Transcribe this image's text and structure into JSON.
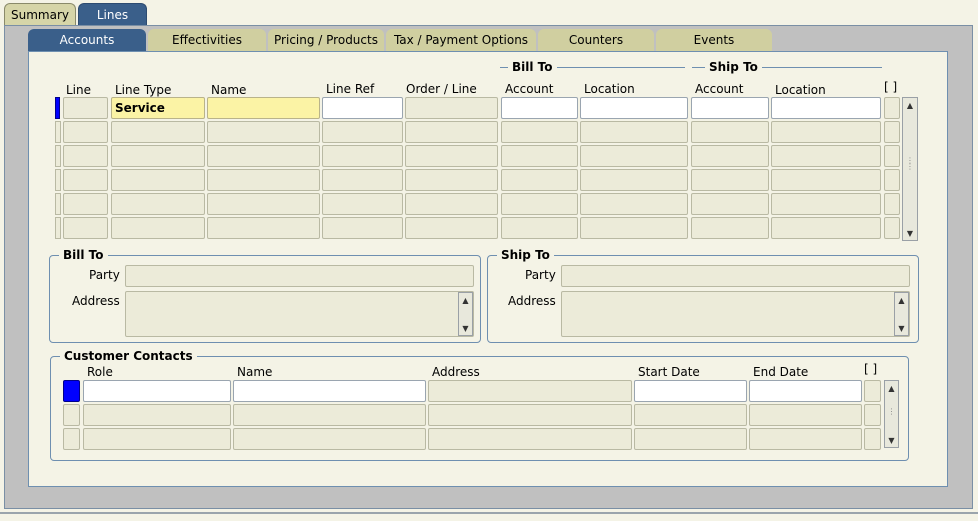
{
  "outer_tabs": [
    "Summary",
    "Lines"
  ],
  "inner_tabs": [
    "Accounts",
    "Effectivities",
    "Pricing / Products",
    "Tax / Payment Options",
    "Counters",
    "Events"
  ],
  "lines_table": {
    "group_bill_to": "Bill To",
    "group_ship_to": "Ship To",
    "columns": {
      "line": "Line",
      "line_type": "Line Type",
      "name": "Name",
      "line_ref": "Line Ref",
      "order_line": "Order / Line",
      "bill_account": "Account",
      "bill_location": "Location",
      "ship_account": "Account",
      "ship_location": "Location",
      "flex": "[ ]"
    },
    "rows": [
      {
        "line_type": "Service"
      }
    ]
  },
  "bill_to": {
    "title": "Bill To",
    "party_label": "Party",
    "address_label": "Address"
  },
  "ship_to": {
    "title": "Ship To",
    "party_label": "Party",
    "address_label": "Address"
  },
  "contacts": {
    "title": "Customer Contacts",
    "columns": {
      "role": "Role",
      "name": "Name",
      "address": "Address",
      "start_date": "Start Date",
      "end_date": "End Date",
      "flex": "[ ]"
    }
  },
  "colors": {
    "tab_active": "#3a5f8a",
    "tab_inactive": "#d0cfa0",
    "required_field": "#fbf3a5",
    "selected_indicator": "#0000ff"
  }
}
